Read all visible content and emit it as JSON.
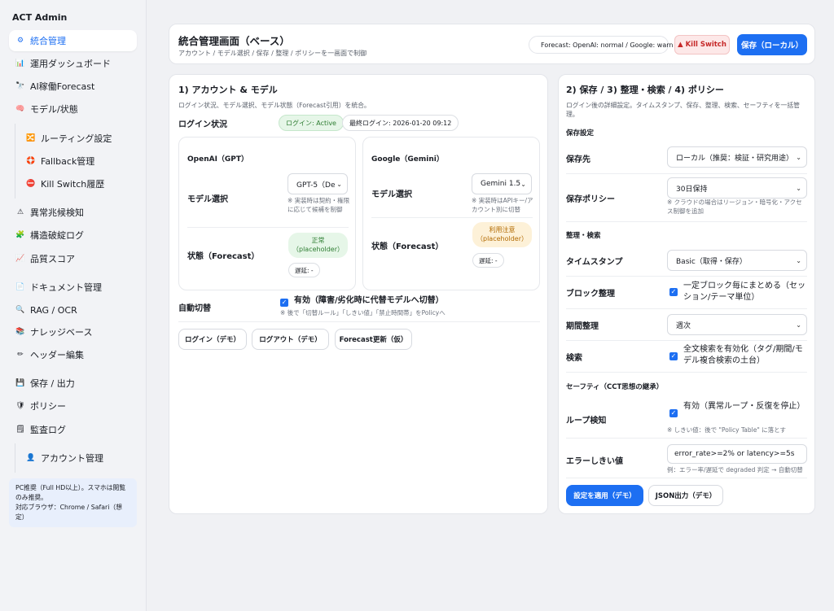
{
  "sidebar": {
    "brand": "ACT Admin",
    "items": [
      {
        "label": "統合管理",
        "icon": "⚙"
      },
      {
        "label": "運用ダッシュボード",
        "icon": "📊"
      },
      {
        "label": "AI稼働Forecast",
        "icon": "🔭"
      },
      {
        "label": "モデル/状態",
        "icon": "🧠"
      },
      {
        "label": "ルーティング設定",
        "icon": "🔀"
      },
      {
        "label": "Fallback管理",
        "icon": "🛟"
      },
      {
        "label": "Kill Switch履歴",
        "icon": "⛔"
      },
      {
        "label": "異常兆候検知",
        "icon": "⚠"
      },
      {
        "label": "構造破綻ログ",
        "icon": "🧩"
      },
      {
        "label": "品質スコア",
        "icon": "📈"
      },
      {
        "label": "ドキュメント管理",
        "icon": "📄"
      },
      {
        "label": "RAG / OCR",
        "icon": "🔍"
      },
      {
        "label": "ナレッジベース",
        "icon": "📚"
      },
      {
        "label": "ヘッダー編集",
        "icon": "✏"
      },
      {
        "label": "保存 / 出力",
        "icon": "💾"
      },
      {
        "label": "ポリシー",
        "icon": "🛡"
      },
      {
        "label": "監査ログ",
        "icon": "🗒"
      },
      {
        "label": "アカウント管理",
        "icon": "👤"
      }
    ],
    "note": "PC推奨（Full HD以上）。スマホは閲覧のみ推奨。\n対応ブラウザ：Chrome / Safari（想定）"
  },
  "header": {
    "title": "統合管理画面（ベース）",
    "subtitle": "アカウント / モデル選択 / 保存 / 整理 / ポリシーを一画面で制御",
    "forecast_pill": "Forecast: OpenAI: normal / Google: warn",
    "kill_switch": "▲ Kill Switch",
    "save_button": "保存（ローカル）"
  },
  "left_panel": {
    "title": "1) アカウント & モデル",
    "subtitle": "ログイン状況、モデル選択、モデル状態（Forecast引用）を統合。",
    "login_label": "ログイン状況",
    "login_status": "ログイン: Active",
    "last_login": "最終ログイン: 2026-01-20 09:12",
    "openai": {
      "title": "OpenAI（GPT）",
      "model_label": "モデル選択",
      "model_value": "GPT-5（De",
      "model_hint": "※ 実装時は契約・権限に応じて候補を制御",
      "state_label": "状態（Forecast）",
      "state_value": "正常\n（placeholder）",
      "latency": "遅延: -",
      "status_color": "#2e7d32",
      "status_bg": "#e6f6e8"
    },
    "google": {
      "title": "Google（Gemini）",
      "model_label": "モデル選択",
      "model_value": "Gemini 1.5",
      "model_hint": "※ 実装時はAPIキー/アカウント別に切替",
      "state_label": "状態（Forecast）",
      "state_value": "利用注意\n（placeholder）",
      "latency": "遅延: -",
      "status_color": "#b26a00",
      "status_bg": "#fdf1d8"
    },
    "auto_switch_label": "自動切替",
    "auto_switch_check": "有効（障害/劣化時に代替モデルへ切替）",
    "auto_switch_hint": "※ 後で「切替ルール」「しきい値」「禁止時間帯」をPolicyへ",
    "buttons": [
      "ログイン（デモ）",
      "ログアウト（デモ）",
      "Forecast更新（仮）"
    ]
  },
  "right_panel": {
    "title": "2) 保存 / 3) 整理・検索 / 4) ポリシー",
    "subtitle": "ログイン後の詳細設定。タイムスタンプ、保存、整理、検索、セーフティを一括管理。",
    "save_section": "保存設定",
    "save_dest_label": "保存先",
    "save_dest_value": "ローカル（推奨：検証・研究用途）",
    "save_policy_label": "保存ポリシー",
    "save_policy_value": "30日保持",
    "save_policy_hint": "※ クラウドの場合はリージョン・暗号化・アクセス制御を追加",
    "org_section": "整理・検索",
    "timestamp_label": "タイムスタンプ",
    "timestamp_value": "Basic（取得・保存）",
    "block_label": "ブロック整理",
    "block_check": "一定ブロック毎にまとめる（セッション/テーマ単位）",
    "period_label": "期間整理",
    "period_value": "週次",
    "search_label": "検索",
    "search_check": "全文検索を有効化（タグ/期間/モデル複合検索の土台）",
    "safety_section": "セーフティ（CCT思想の継承）",
    "loop_label": "ループ検知",
    "loop_check": "有効（異常ループ・反復を停止）",
    "loop_hint": "※ しきい値：後で \"Policy Table\" に落とす",
    "error_label": "エラーしきい値",
    "error_value": "error_rate>=2% or latency>=5s",
    "error_hint": "例：エラー率/遅延で degraded 判定 → 自動切替",
    "apply_button": "設定を適用（デモ）",
    "json_button": "JSON出力（デモ）"
  }
}
